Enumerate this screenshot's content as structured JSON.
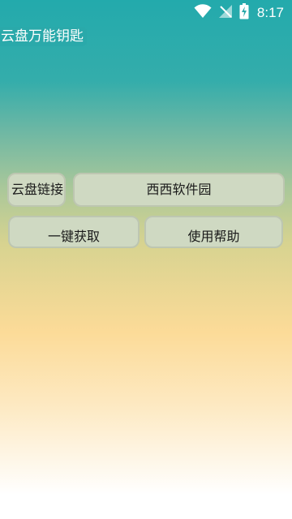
{
  "status_bar": {
    "time": "8:17",
    "icons": [
      "wifi-icon",
      "signal-off-icon",
      "battery-charging-icon"
    ]
  },
  "app": {
    "title": "云盘万能钥匙"
  },
  "buttons": {
    "link": "云盘链接",
    "site": "西西软件园",
    "fetch": "一键获取",
    "help": "使用帮助"
  },
  "colors": {
    "status_icon": "#ffffff",
    "button_bg": "#cfd9c2",
    "title_bg": "#2aa9aa"
  }
}
